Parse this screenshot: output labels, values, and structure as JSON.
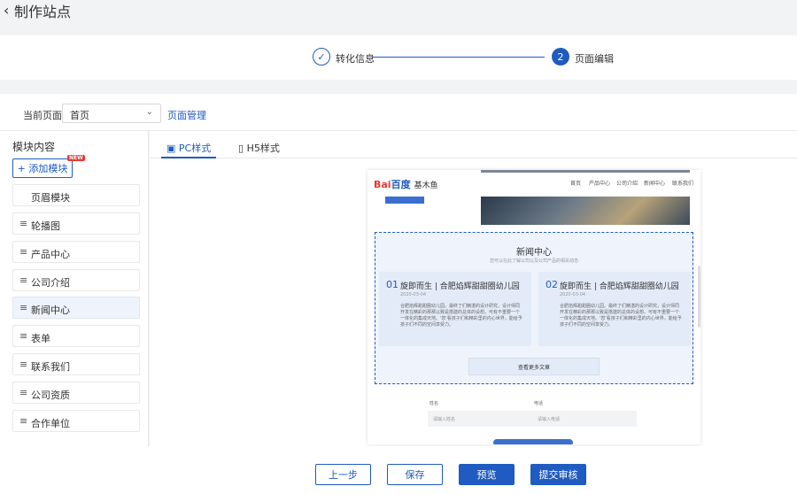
{
  "header": {
    "title": "制作站点"
  },
  "steps": [
    {
      "label": "转化信息",
      "done": true
    },
    {
      "label": "页面编辑",
      "number": "2",
      "active": true
    }
  ],
  "toolbar": {
    "current_page_label": "当前页面:",
    "current_page_value": "首页",
    "page_manage_link": "页面管理"
  },
  "sidebar": {
    "title": "模块内容",
    "add_button": "添加模块",
    "new_badge": "NEW",
    "header_item": "页眉模块",
    "items": [
      {
        "label": "轮播图"
      },
      {
        "label": "产品中心"
      },
      {
        "label": "公司介绍"
      },
      {
        "label": "新闻中心",
        "active": true
      },
      {
        "label": "表单"
      },
      {
        "label": "联系我们"
      },
      {
        "label": "公司资质"
      },
      {
        "label": "合作单位"
      }
    ]
  },
  "tabs": [
    {
      "label": "PC样式",
      "active": true
    },
    {
      "label": "H5样式"
    }
  ],
  "preview": {
    "logo_bai": "Bai",
    "logo_du": "百度",
    "brand": "基木鱼",
    "nav": [
      "首页",
      "产品中心",
      "公司介绍",
      "新闻中心",
      "联系我们"
    ],
    "news": {
      "title": "新闻中心",
      "subtitle": "您可以在此了解公司以及公司产品的相关动态",
      "cards": [
        {
          "num": "01",
          "title": "旋即而生 | 合肥焰辉甜甜圈幼儿园",
          "date": "2020-03-04",
          "body": "合肥焰辉甜甜圈幼儿园。最终了们精湛的设计研究，设计师同开发在精彩的那那以致是搭建的总体的设想。可有不重要一个一体化的集成天地。'您'看孩子们和精彩里的内心世界，能给予孩子们不同的空间享受力。"
        },
        {
          "num": "02",
          "title": "旋即而生 | 合肥焰辉甜甜圈幼儿园",
          "date": "2020-03-04",
          "body": "合肥焰辉甜甜圈幼儿园。最终了们精湛的设计研究，设计师同开发在精彩的那那以致是搭建的总体的设想。可有不重要一个一体化的集成天地。'您'看孩子们和精彩里的内心世界，能给予孩子们不同的空间享受力。"
        }
      ],
      "more": "查看更多文章"
    },
    "form": {
      "name_label": "姓名",
      "name_placeholder": "请输入姓名",
      "phone_label": "电话",
      "phone_placeholder": "请输入电话"
    }
  },
  "footer": {
    "prev": "上一步",
    "save": "保存",
    "preview": "预览",
    "submit": "提交审核"
  }
}
